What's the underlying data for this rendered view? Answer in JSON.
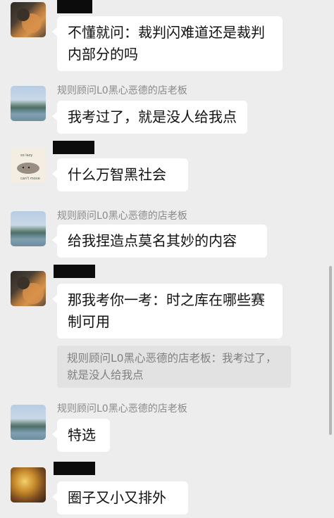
{
  "messages": [
    {
      "avatar": "cat-avatar",
      "name": "",
      "text": "不懂就问：裁判闪难道还是裁判内部分的吗"
    },
    {
      "avatar": "lake-avatar",
      "name": "规则顾问L0黑心恶德的店老板",
      "text": "我考过了，就是没人给我点"
    },
    {
      "avatar": "pusheen-avatar",
      "name": "",
      "text": "什么万智黑社会",
      "avatar_caption_1": "so lazy",
      "avatar_caption_2": "can't move"
    },
    {
      "avatar": "lake-avatar",
      "name": "规则顾问L0黑心恶德的店老板",
      "text": "给我捏造点莫名其妙的内容"
    },
    {
      "avatar": "cat-avatar",
      "name": "",
      "text": "那我考你一考：时之库在哪些赛制可用",
      "quote": "规则顾问L0黑心恶德的店老板：我考过了，就是没人给我点"
    },
    {
      "avatar": "lake-avatar",
      "name": "规则顾问L0黑心恶德的店老板",
      "text": "特选"
    },
    {
      "avatar": "gold-avatar",
      "name": "",
      "text": "圈子又小又排外"
    }
  ],
  "colors": {
    "background": "#ededed",
    "bubble": "#ffffff",
    "quote_bg": "#e2e2e2",
    "redaction": "#0c0c0c"
  }
}
